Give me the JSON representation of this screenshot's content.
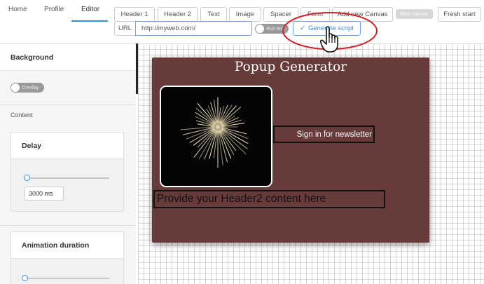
{
  "nav": {
    "tabs": [
      "Home",
      "Profile",
      "Editor"
    ],
    "active": "Editor"
  },
  "toolbar": {
    "buttons": [
      "Header 1",
      "Header 2",
      "Text",
      "Image",
      "Spacer",
      "Form",
      "Add new Canvas"
    ],
    "main_canvas_label": "Main canvas",
    "fresh_start_label": "Fresh start",
    "url_label": "URL",
    "url_value": "http://myweb.com/",
    "run_test_label": "Run test",
    "generate_label": "Generate script"
  },
  "sidebar": {
    "background_heading": "Background",
    "overlay_label": "Overlay",
    "content_label": "Content",
    "delay": {
      "heading": "Delay",
      "value": "3000 ms",
      "slider_fraction": 0.0
    },
    "animation": {
      "heading": "Animation duration",
      "slider_fraction": 0.0
    }
  },
  "popup": {
    "title": "Popup Generator",
    "subheader": "Sign in for newsletter",
    "header2": "Provide your Header2 content here",
    "image_icon": "fireworks-image",
    "background_color": "#683b3b"
  },
  "colors": {
    "accent": "#3b8fd8",
    "highlight": "#d0202a"
  }
}
